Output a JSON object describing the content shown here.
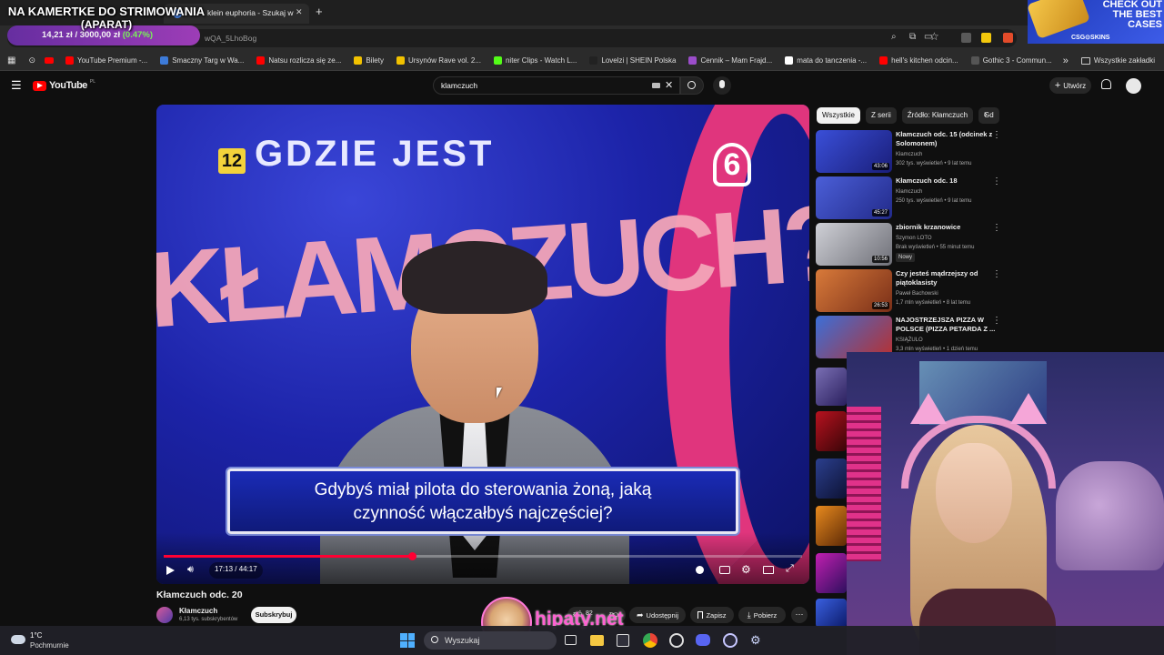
{
  "overlay": {
    "stream_title_line1": "NA KAMERTKE DO STRIMOWANIA",
    "stream_title_line2": "(APARAT)",
    "goal_current": "14,21 zł",
    "goal_separator": "/",
    "goal_target": "3000,00 zł",
    "goal_percent": "(0.47%)",
    "ad_line1": "CHECK OUT",
    "ad_line2": "THE BEST",
    "ad_line3": "CASES",
    "ad_brand": "CSG⊙SKINS",
    "watermark": "hipaty.net"
  },
  "browser": {
    "tab_visible_text": "klein euphoria - Szukaj w",
    "tab_close": "✕",
    "new_tab": "+",
    "url_fragment": "wQA_5LhoBog",
    "bookmarks": [
      {
        "label": "YouTube Premium -...",
        "color": "#ff0000"
      },
      {
        "label": "Smaczny Targ w Wa...",
        "color": "#3d7bd9"
      },
      {
        "label": "Natsu rozlicza się ze...",
        "color": "#ff0000"
      },
      {
        "label": "Bilety",
        "color": "#f2c200"
      },
      {
        "label": "Ursynów Rave vol. 2...",
        "color": "#f2c200"
      },
      {
        "label": "niter Clips - Watch L...",
        "color": "#53fc18"
      },
      {
        "label": "Lovelzi | SHEIN Polska",
        "color": "#222222"
      },
      {
        "label": "Cennik – Mam Frajd...",
        "color": "#9b4dca"
      },
      {
        "label": "mata do tanczenia -...",
        "color": "#ffffff"
      },
      {
        "label": "hell's kitchen odcin...",
        "color": "#ff0000"
      },
      {
        "label": "Gothic 3 - Commun...",
        "color": "#555555"
      }
    ],
    "bookmarks_more": "»",
    "all_bookmarks": "Wszystkie zakładki"
  },
  "youtube": {
    "logo_text": "YouTube",
    "logo_region": "PL",
    "search_value": "klamczuch",
    "create_label": "Utwórz",
    "video": {
      "title": "Kłamczuch odc. 20",
      "channel": "Kłamczuch",
      "subscribers": "6,13 tys. subskrybentów",
      "subscribe_label": "Subskrybuj",
      "time": "17:13 / 44:17",
      "progress": 0.389,
      "like_count": "82",
      "share_label": "Udostępnij",
      "save_label": "Zapisz",
      "download_label": "Pobierz",
      "show_title": "GDZIE JEST",
      "show_logo": "KŁAMCZUCH?",
      "rating_badge": "12",
      "channel_badge": "6",
      "subtitle_line1": "Gdybyś miał pilota do sterowania żoną, jaką",
      "subtitle_line2": "czynność włączałbyś najczęściej?"
    },
    "chips": [
      "Wszystkie",
      "Z serii",
      "Źródło: Kłamczuch",
      "Gd"
    ],
    "recommendations": [
      {
        "title": "Kłamczuch odc. 15 (odcinek z Solomonem)",
        "channel": "Kłamczuch",
        "stats": "302 tys. wyświetleń • 9 lat temu",
        "duration": "43:06",
        "badge": ""
      },
      {
        "title": "Kłamczuch odc. 18",
        "channel": "Kłamczuch",
        "stats": "250 tys. wyświetleń • 9 lat temu",
        "duration": "45:27",
        "badge": ""
      },
      {
        "title": "zbiornik krzanowice",
        "channel": "Szymon LOTO",
        "stats": "Brak wyświetleń • 55 minut temu",
        "duration": "10:56",
        "badge": "Nowy"
      },
      {
        "title": "Czy jesteś mądrzejszy od piątoklasisty",
        "channel": "Paweł Bachowski",
        "stats": "1,7 mln wyświetleń • 8 lat temu",
        "duration": "26:53",
        "badge": ""
      },
      {
        "title": "NAJOSTRZEJSZA PIZZA W POLSCE (PIZZA PETARDA Z ...",
        "channel": "KSIĄŻULO",
        "stats": "3,3 mln wyświetleń • 1 dzień temu",
        "duration": "",
        "badge": ""
      }
    ]
  },
  "taskbar": {
    "temperature": "1°C",
    "weather": "Pochmurnie",
    "search_placeholder": "Wyszukaj"
  }
}
